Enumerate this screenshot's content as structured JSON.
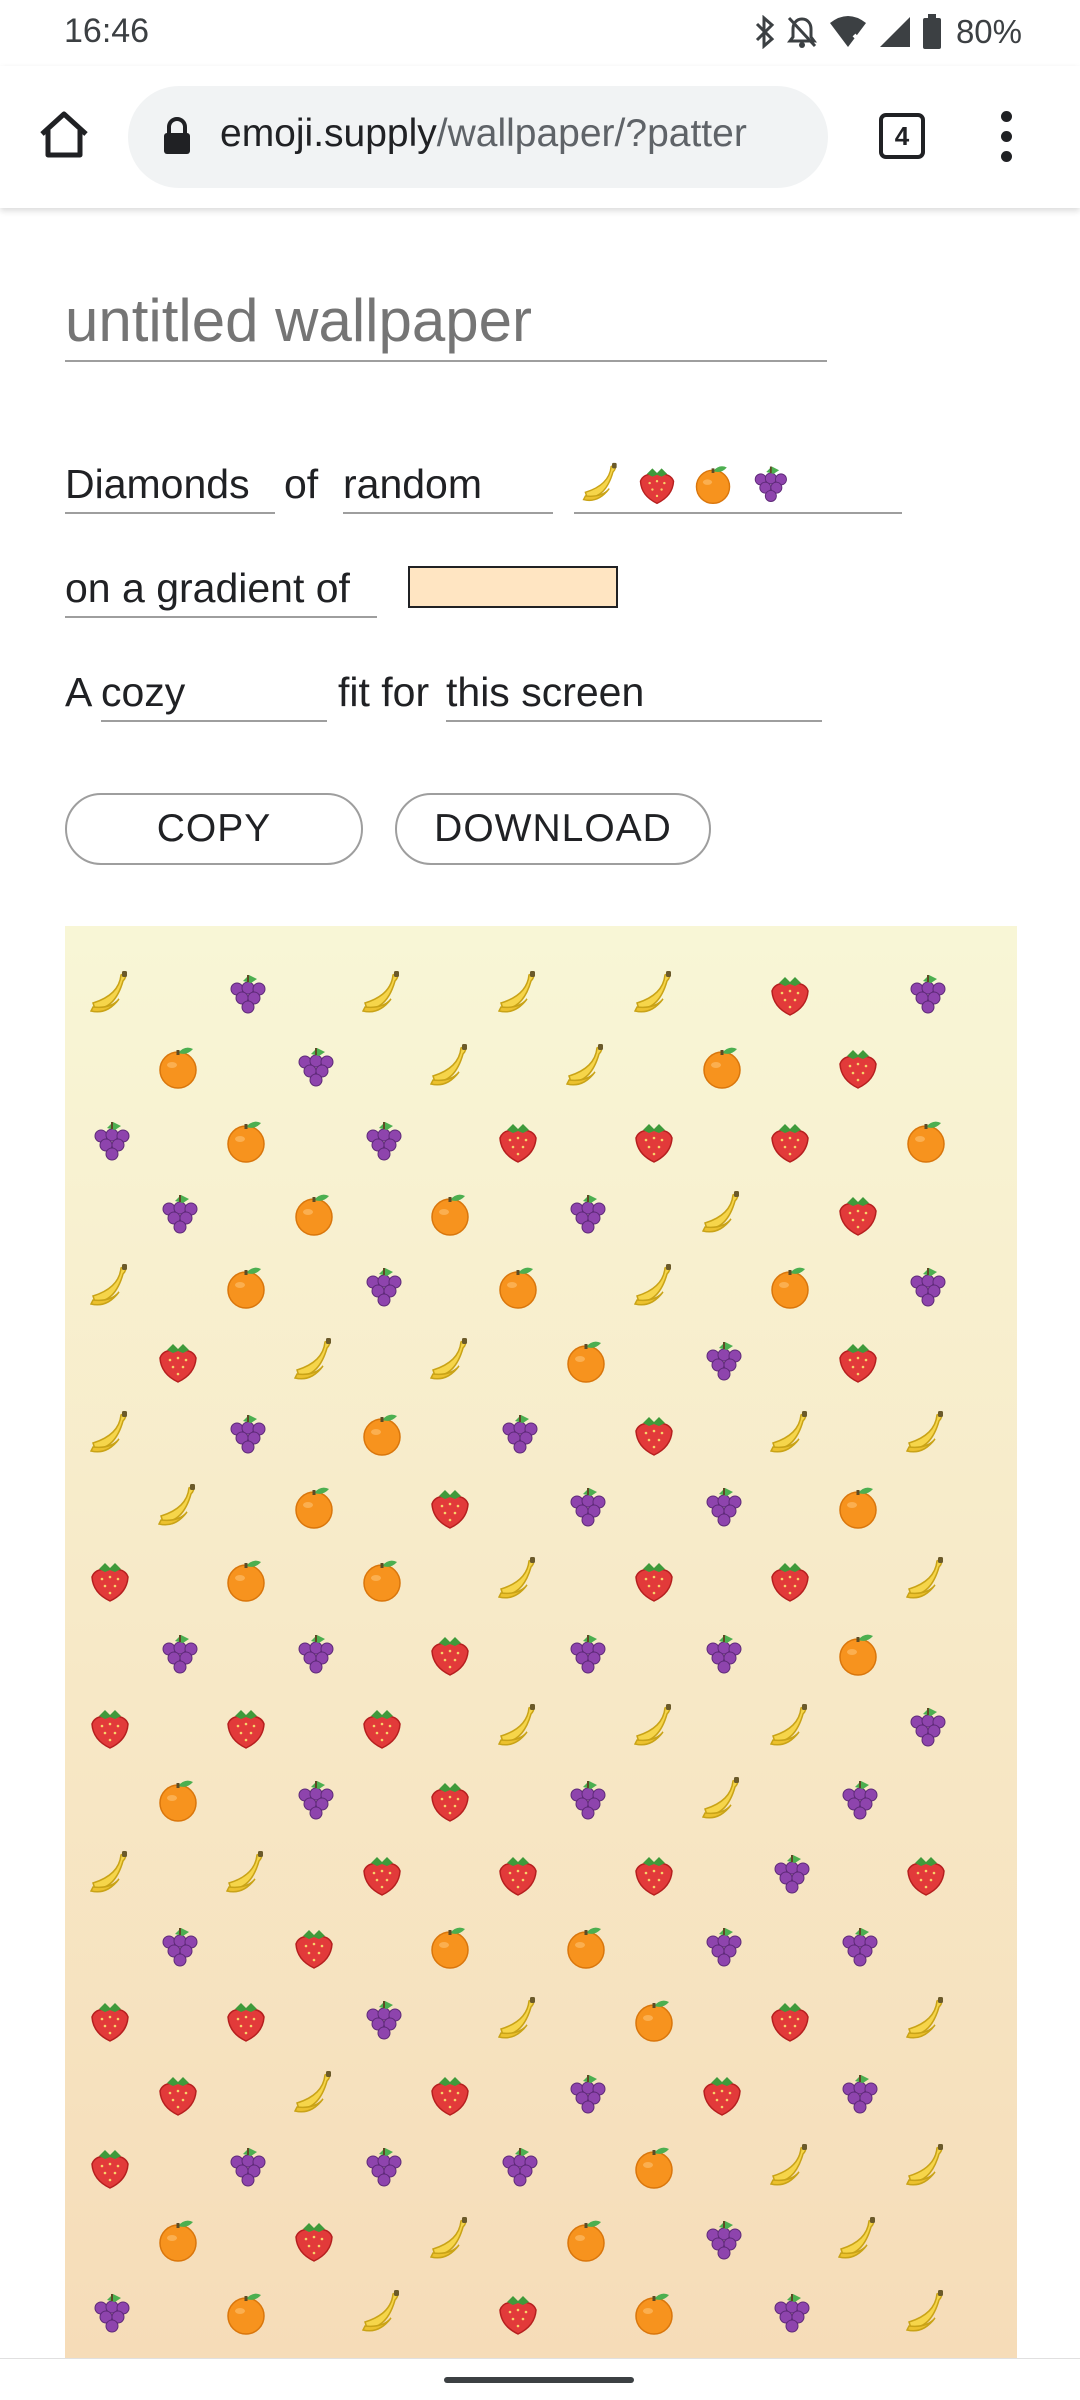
{
  "status": {
    "time": "16:46",
    "battery": "80%",
    "icons": [
      "bluetooth-icon",
      "notifications-off-icon",
      "wifi-icon",
      "cell-signal-icon",
      "battery-icon"
    ]
  },
  "browser": {
    "url_domain": "emoji.supply",
    "url_path": "/wallpaper/?patter",
    "tab_count": "4"
  },
  "form": {
    "title_placeholder": "untitled wallpaper",
    "pattern": "Diamonds",
    "of_label": "of",
    "mode": "random",
    "emojis": [
      "banana",
      "strawberry",
      "tangerine",
      "grapes"
    ],
    "gradient_label": "on a gradient of",
    "gradient_color": "#ffe5c2",
    "size_prefix": "A",
    "size": "cozy",
    "fit_label": "fit for",
    "target": "this screen"
  },
  "buttons": {
    "copy": "COPY",
    "download": "DOWNLOAD"
  },
  "preview": {
    "gradient_top": "#f8f6d6",
    "gradient_bottom": "#f6dcb8",
    "rows": [
      [
        "banana",
        "grapes",
        "banana",
        "banana",
        "banana",
        "strawberry",
        "grapes"
      ],
      [
        "tangerine",
        "grapes",
        "banana",
        "banana",
        "tangerine",
        "strawberry"
      ],
      [
        "grapes",
        "tangerine",
        "grapes",
        "strawberry",
        "strawberry",
        "strawberry",
        "tangerine"
      ],
      [
        "grapes",
        "tangerine",
        "tangerine",
        "grapes",
        "banana",
        "strawberry"
      ],
      [
        "banana",
        "tangerine",
        "grapes",
        "tangerine",
        "banana",
        "tangerine",
        "grapes"
      ],
      [
        "strawberry",
        "banana",
        "banana",
        "tangerine",
        "grapes",
        "strawberry"
      ],
      [
        "banana",
        "grapes",
        "tangerine",
        "grapes",
        "strawberry",
        "banana",
        "banana"
      ],
      [
        "banana",
        "tangerine",
        "strawberry",
        "grapes",
        "grapes",
        "tangerine"
      ],
      [
        "strawberry",
        "tangerine",
        "tangerine",
        "banana",
        "strawberry",
        "strawberry",
        "banana"
      ],
      [
        "grapes",
        "grapes",
        "strawberry",
        "grapes",
        "grapes",
        "tangerine"
      ],
      [
        "strawberry",
        "strawberry",
        "strawberry",
        "banana",
        "banana",
        "banana",
        "grapes"
      ],
      [
        "tangerine",
        "grapes",
        "strawberry",
        "grapes",
        "banana",
        "grapes"
      ],
      [
        "banana",
        "banana",
        "strawberry",
        "strawberry",
        "strawberry",
        "grapes",
        "strawberry"
      ],
      [
        "grapes",
        "strawberry",
        "tangerine",
        "tangerine",
        "grapes",
        "grapes"
      ],
      [
        "strawberry",
        "strawberry",
        "grapes",
        "banana",
        "tangerine",
        "strawberry",
        "banana"
      ],
      [
        "strawberry",
        "banana",
        "strawberry",
        "grapes",
        "strawberry",
        "grapes"
      ],
      [
        "strawberry",
        "grapes",
        "grapes",
        "grapes",
        "tangerine",
        "banana",
        "banana"
      ],
      [
        "tangerine",
        "strawberry",
        "banana",
        "tangerine",
        "grapes",
        "banana"
      ],
      [
        "grapes",
        "tangerine",
        "banana",
        "strawberry",
        "tangerine",
        "grapes",
        "banana"
      ]
    ]
  }
}
